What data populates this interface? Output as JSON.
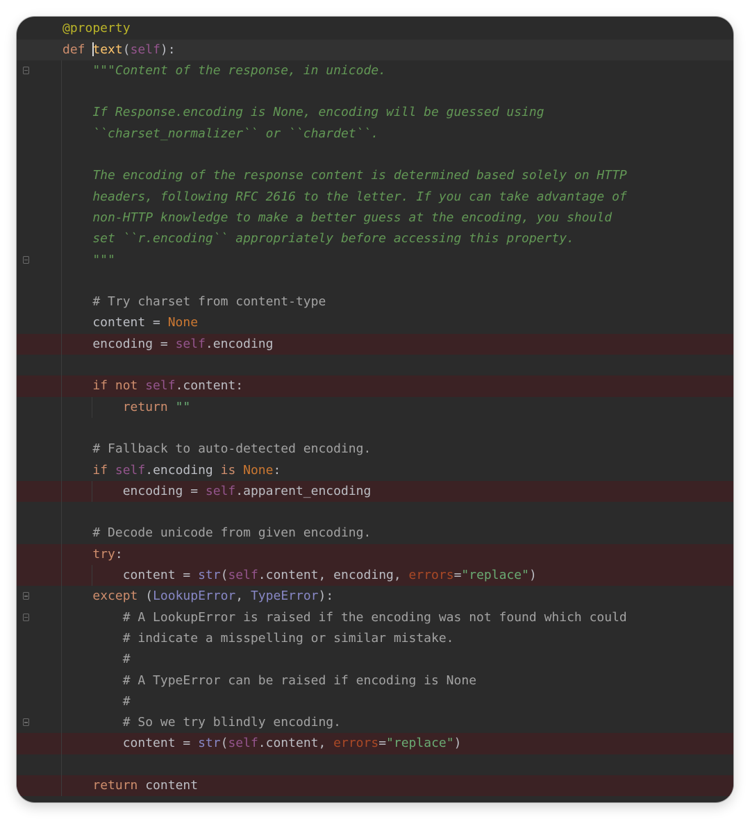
{
  "editor": {
    "lines": [
      [
        {
          "t": "@property",
          "c": "deco"
        }
      ],
      [
        {
          "t": "def ",
          "c": "kw"
        },
        {
          "t": "",
          "c": "caret"
        },
        {
          "t": "text",
          "c": "fn"
        },
        {
          "t": "(",
          "c": ""
        },
        {
          "t": "self",
          "c": "self"
        },
        {
          "t": "):",
          "c": ""
        }
      ],
      [
        {
          "t": "    \"\"\"Content of the response, in unicode.",
          "c": "doc"
        }
      ],
      [
        {
          "t": "",
          "c": ""
        }
      ],
      [
        {
          "t": "    If Response.encoding is None, encoding will be guessed using",
          "c": "doc"
        }
      ],
      [
        {
          "t": "    ``charset_normalizer`` or ``chardet``.",
          "c": "doc"
        }
      ],
      [
        {
          "t": "",
          "c": ""
        }
      ],
      [
        {
          "t": "    The encoding of the response content is determined based solely on HTTP",
          "c": "doc"
        }
      ],
      [
        {
          "t": "    headers, following RFC 2616 to the letter. If you can take advantage of",
          "c": "doc"
        }
      ],
      [
        {
          "t": "    non-HTTP knowledge to make a better guess at the encoding, you should",
          "c": "doc"
        }
      ],
      [
        {
          "t": "    set ``r.encoding`` appropriately before accessing this property.",
          "c": "doc"
        }
      ],
      [
        {
          "t": "    \"\"\"",
          "c": "doc"
        }
      ],
      [
        {
          "t": "",
          "c": ""
        }
      ],
      [
        {
          "t": "    # Try charset from content-type",
          "c": "cmt"
        }
      ],
      [
        {
          "t": "    content = ",
          "c": ""
        },
        {
          "t": "None",
          "c": "none"
        }
      ],
      [
        {
          "t": "    encoding = ",
          "c": ""
        },
        {
          "t": "self",
          "c": "self"
        },
        {
          "t": ".encoding",
          "c": ""
        }
      ],
      [
        {
          "t": "",
          "c": ""
        }
      ],
      [
        {
          "t": "    ",
          "c": ""
        },
        {
          "t": "if not ",
          "c": "kw"
        },
        {
          "t": "self",
          "c": "self"
        },
        {
          "t": ".content:",
          "c": ""
        }
      ],
      [
        {
          "t": "        ",
          "c": ""
        },
        {
          "t": "return ",
          "c": "kw"
        },
        {
          "t": "\"\"",
          "c": "str"
        }
      ],
      [
        {
          "t": "",
          "c": ""
        }
      ],
      [
        {
          "t": "    # Fallback to auto-detected encoding.",
          "c": "cmt"
        }
      ],
      [
        {
          "t": "    ",
          "c": ""
        },
        {
          "t": "if ",
          "c": "kw"
        },
        {
          "t": "self",
          "c": "self"
        },
        {
          "t": ".encoding ",
          "c": ""
        },
        {
          "t": "is ",
          "c": "kw"
        },
        {
          "t": "None",
          "c": "none"
        },
        {
          "t": ":",
          "c": ""
        }
      ],
      [
        {
          "t": "        encoding = ",
          "c": ""
        },
        {
          "t": "self",
          "c": "self"
        },
        {
          "t": ".apparent_encoding",
          "c": ""
        }
      ],
      [
        {
          "t": "",
          "c": ""
        }
      ],
      [
        {
          "t": "    # Decode unicode from given encoding.",
          "c": "cmt"
        }
      ],
      [
        {
          "t": "    ",
          "c": ""
        },
        {
          "t": "try",
          "c": "kw"
        },
        {
          "t": ":",
          "c": ""
        }
      ],
      [
        {
          "t": "        content = ",
          "c": ""
        },
        {
          "t": "str",
          "c": "cls"
        },
        {
          "t": "(",
          "c": ""
        },
        {
          "t": "self",
          "c": "self"
        },
        {
          "t": ".content, encoding, ",
          "c": ""
        },
        {
          "t": "errors",
          "c": "param"
        },
        {
          "t": "=",
          "c": ""
        },
        {
          "t": "\"replace\"",
          "c": "str"
        },
        {
          "t": ")",
          "c": ""
        }
      ],
      [
        {
          "t": "    ",
          "c": ""
        },
        {
          "t": "except ",
          "c": "kw"
        },
        {
          "t": "(",
          "c": ""
        },
        {
          "t": "LookupError",
          "c": "cls"
        },
        {
          "t": ", ",
          "c": ""
        },
        {
          "t": "TypeError",
          "c": "cls"
        },
        {
          "t": "):",
          "c": ""
        }
      ],
      [
        {
          "t": "        # A LookupError is raised if the encoding was not found which could",
          "c": "cmt"
        }
      ],
      [
        {
          "t": "        # indicate a misspelling or similar mistake.",
          "c": "cmt"
        }
      ],
      [
        {
          "t": "        #",
          "c": "cmt"
        }
      ],
      [
        {
          "t": "        # A TypeError can be raised if encoding is None",
          "c": "cmt"
        }
      ],
      [
        {
          "t": "        #",
          "c": "cmt"
        }
      ],
      [
        {
          "t": "        # So we try blindly encoding.",
          "c": "cmt"
        }
      ],
      [
        {
          "t": "        content = ",
          "c": ""
        },
        {
          "t": "str",
          "c": "cls"
        },
        {
          "t": "(",
          "c": ""
        },
        {
          "t": "self",
          "c": "self"
        },
        {
          "t": ".content, ",
          "c": ""
        },
        {
          "t": "errors",
          "c": "param"
        },
        {
          "t": "=",
          "c": ""
        },
        {
          "t": "\"replace\"",
          "c": "str"
        },
        {
          "t": ")",
          "c": ""
        }
      ],
      [
        {
          "t": "",
          "c": ""
        }
      ],
      [
        {
          "t": "    ",
          "c": ""
        },
        {
          "t": "return ",
          "c": "kw"
        },
        {
          "t": "content",
          "c": ""
        }
      ]
    ],
    "highlighted_lines": [
      15,
      17,
      22,
      25,
      26,
      34,
      36
    ],
    "current_line": 1,
    "fold_markers": [
      2,
      3,
      12,
      28,
      29,
      34,
      35,
      37
    ],
    "colors": {
      "background": "#2b2b2b",
      "keyword": "#cf8e6d",
      "docstring": "#629755",
      "comment": "#a3a3a3",
      "string": "#6aab73",
      "highlight": "#3b2224"
    },
    "gutter_icon": "lightbulb-icon"
  }
}
